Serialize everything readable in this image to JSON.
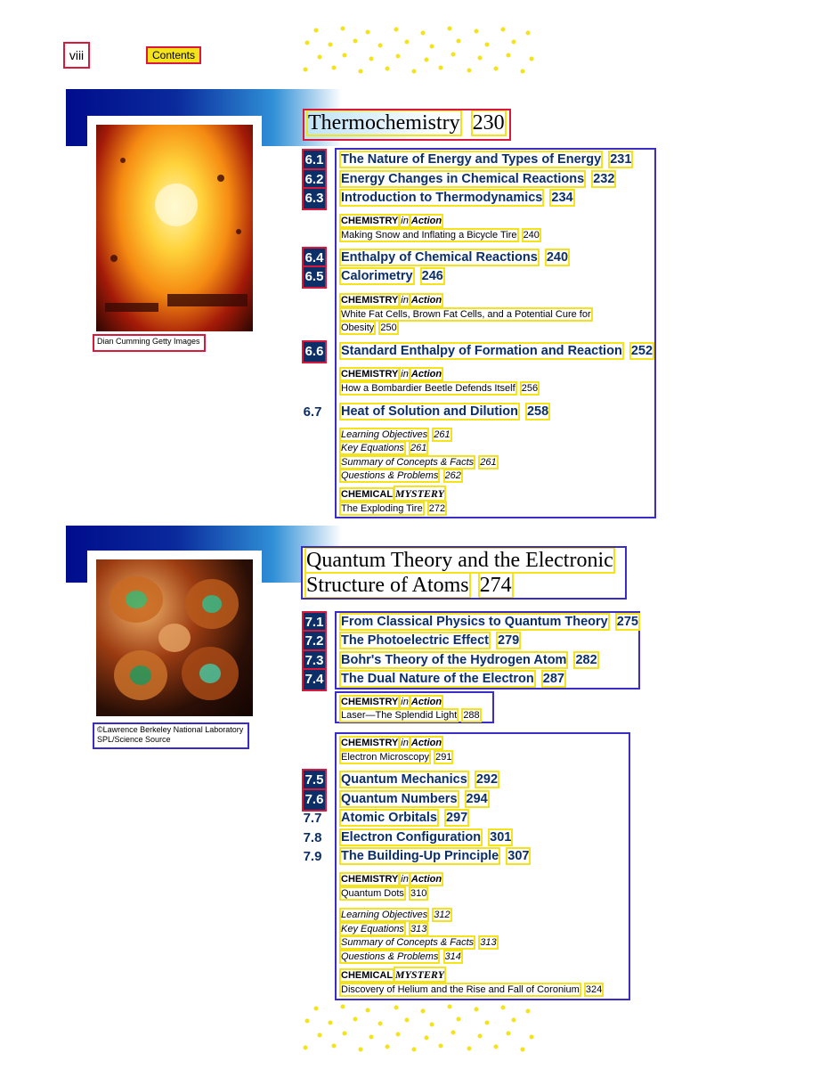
{
  "header": {
    "page_number": "viii",
    "section": "Contents"
  },
  "chapter6": {
    "title": "Thermochemistry",
    "page": "230",
    "photo_credit": "Dian Cumming Getty Images",
    "sections": [
      {
        "num": "6.1",
        "title": "The Nature of Energy and Types of Energy",
        "page": "231"
      },
      {
        "num": "6.2",
        "title": "Energy Changes in Chemical Reactions",
        "page": "232"
      },
      {
        "num": "6.3",
        "title": "Introduction to Thermodynamics",
        "page": "234"
      },
      {
        "num": "6.4",
        "title": "Enthalpy of Chemical Reactions",
        "page": "240"
      },
      {
        "num": "6.5",
        "title": "Calorimetry",
        "page": "246"
      },
      {
        "num": "6.6",
        "title": "Standard Enthalpy of Formation and Reaction",
        "page": "252"
      },
      {
        "num": "6.7",
        "title": "Heat of Solution and Dilution",
        "page": "258"
      }
    ],
    "cia1": {
      "label_bold": "CHEMISTRY",
      "label_in": "in",
      "label_action": "Action",
      "text": "Making Snow and Inflating a Bicycle Tire",
      "page": "240"
    },
    "cia2": {
      "label_bold": "CHEMISTRY",
      "label_in": "in",
      "label_action": "Action",
      "text_line1": "White Fat Cells, Brown Fat Cells, and a Potential Cure for",
      "text_line2": "Obesity",
      "page": "250"
    },
    "cia3": {
      "label_bold": "CHEMISTRY",
      "label_in": "in",
      "label_action": "Action",
      "text": "How a Bombardier Beetle Defends Itself",
      "page": "256"
    },
    "end": [
      {
        "text": "Learning Objectives",
        "page": "261"
      },
      {
        "text": "Key Equations",
        "page": "261"
      },
      {
        "text": "Summary of Concepts & Facts",
        "page": "261"
      },
      {
        "text": "Questions & Problems",
        "page": "262"
      }
    ],
    "mystery": {
      "label": "CHEMICAL",
      "label2": "MYSTERY",
      "text": "The Exploding Tire",
      "page": "272"
    }
  },
  "chapter7": {
    "title_line1": "Quantum Theory and the Electronic",
    "title_line2": "Structure of Atoms",
    "page": "274",
    "photo_credit_line1": "©Lawrence Berkeley National Laboratory",
    "photo_credit_line2": "SPL/Science Source",
    "sections_a": [
      {
        "num": "7.1",
        "title": "From Classical Physics to Quantum Theory",
        "page": "275"
      },
      {
        "num": "7.2",
        "title": "The Photoelectric Effect",
        "page": "279"
      },
      {
        "num": "7.3",
        "title": "Bohr's Theory of the Hydrogen Atom",
        "page": "282"
      },
      {
        "num": "7.4",
        "title": "The Dual Nature of the Electron",
        "page": "287"
      }
    ],
    "cia1": {
      "label_bold": "CHEMISTRY",
      "label_in": "in",
      "label_action": "Action",
      "text": "Laser—The Splendid Light",
      "page": "288"
    },
    "cia2": {
      "label_bold": "CHEMISTRY",
      "label_in": "in",
      "label_action": "Action",
      "text": "Electron Microscopy",
      "page": "291"
    },
    "sections_b": [
      {
        "num": "7.5",
        "title": "Quantum Mechanics",
        "page": "292"
      },
      {
        "num": "7.6",
        "title": "Quantum Numbers",
        "page": "294"
      },
      {
        "num": "7.7",
        "title": "Atomic Orbitals",
        "page": "297"
      },
      {
        "num": "7.8",
        "title": "Electron Configuration",
        "page": "301"
      },
      {
        "num": "7.9",
        "title": "The Building-Up Principle",
        "page": "307"
      }
    ],
    "cia3": {
      "label_bold": "CHEMISTRY",
      "label_in": "in",
      "label_action": "Action",
      "text": "Quantum Dots",
      "page": "310"
    },
    "end": [
      {
        "text": "Learning Objectives",
        "page": "312"
      },
      {
        "text": "Key Equations",
        "page": "313"
      },
      {
        "text": "Summary of Concepts & Facts",
        "page": "313"
      },
      {
        "text": "Questions & Problems",
        "page": "314"
      }
    ],
    "mystery": {
      "label": "CHEMICAL",
      "label2": "MYSTERY",
      "text": "Discovery of Helium and the Rise and Fall of Coronium",
      "page": "324"
    }
  }
}
